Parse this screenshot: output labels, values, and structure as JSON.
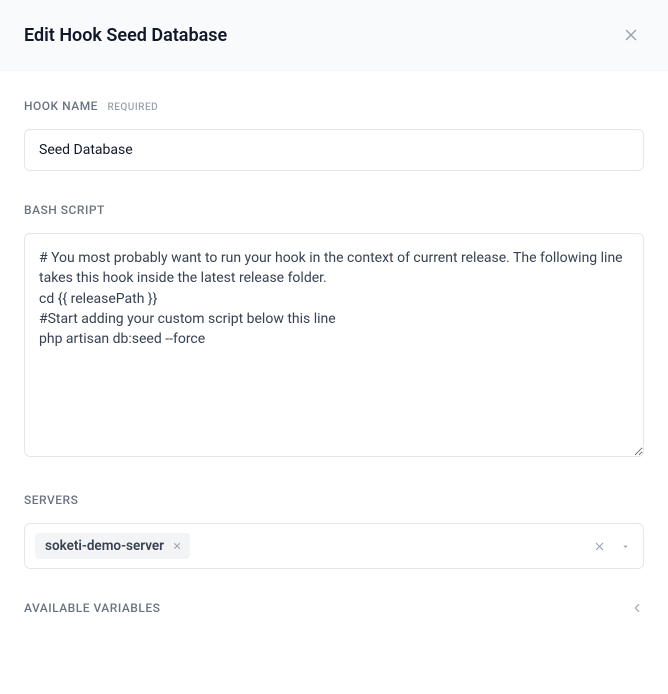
{
  "header": {
    "title": "Edit Hook Seed Database"
  },
  "form": {
    "hookName": {
      "label": "HOOK NAME",
      "requiredTag": "REQUIRED",
      "value": "Seed Database"
    },
    "bashScript": {
      "label": "BASH SCRIPT",
      "value": "# You most probably want to run your hook in the context of current release. The following line takes this hook inside the latest release folder.\ncd {{ releasePath }}\n#Start adding your custom script below this line\nphp artisan db:seed --force"
    },
    "servers": {
      "label": "SERVERS",
      "selected": [
        {
          "name": "soketi-demo-server"
        }
      ]
    },
    "availableVariables": {
      "label": "AVAILABLE VARIABLES"
    }
  }
}
